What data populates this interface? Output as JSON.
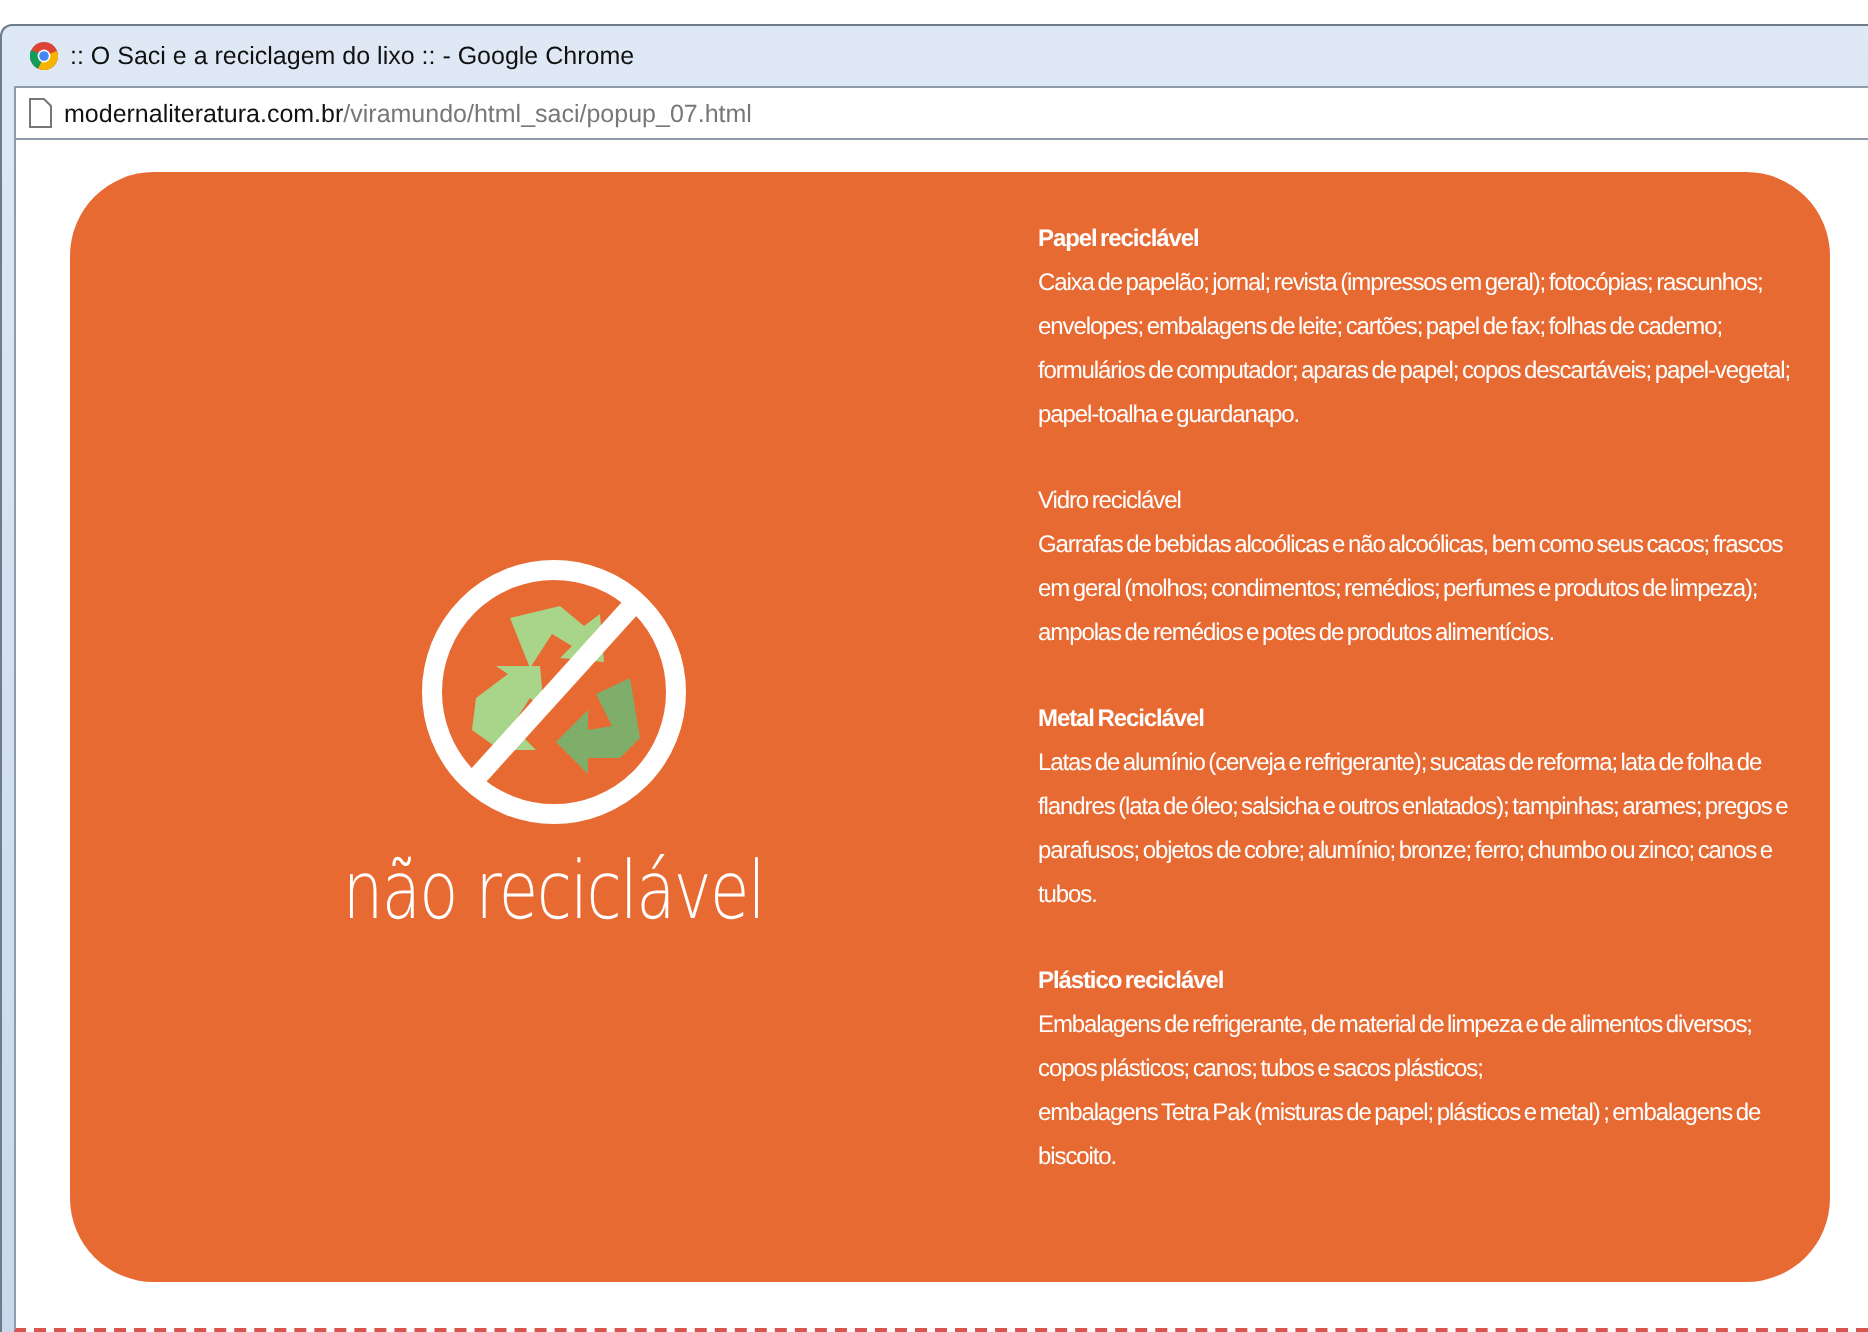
{
  "window": {
    "title": ":: O Saci e a reciclagem do lixo :: - Google Chrome"
  },
  "address_bar": {
    "domain": "modernaliteratura.com.br",
    "path": "/viramundo/html_saci/popup_07.html"
  },
  "card": {
    "caption": "não reciclável",
    "sections": [
      {
        "title": "Papel reciclável",
        "bold": true,
        "paragraphs": [
          "Caixa de papelão; jornal; revista (impressos em geral); fotocópias; rascunhos; envelopes; embalagens de leite; cartões; papel de fax; folhas de cademo; formulários de computador; aparas de papel; copos descartáveis; papel-vegetal; papel-toalha e guardanapo."
        ]
      },
      {
        "title": "Vidro reciclável",
        "bold": false,
        "paragraphs": [
          "Garrafas de bebidas alcoólicas e não alcoólicas, bem como seus cacos; frascos em geral (molhos; condimentos; remédios; perfumes e produtos de limpeza); ampolas de remédios e potes de produtos alimentícios."
        ]
      },
      {
        "title": "Metal Reciclável",
        "bold": true,
        "paragraphs": [
          "Latas de alumínio (cerveja e refrigerante); sucatas de reforma; lata de folha de flandres (lata de óleo; salsicha e outros enlatados); tampinhas; arames; pregos e parafusos; objetos de cobre; alumínio; bronze; ferro; chumbo ou zinco; canos e tubos."
        ]
      },
      {
        "title": "Plástico reciclável",
        "bold": true,
        "paragraphs": [
          "Embalagens de refrigerante, de material de limpeza e de alimentos diversos; copos plásticos; canos; tubos e sacos plásticos;",
          "embalagens Tetra Pak (misturas de papel; plásticos e metal) ; embalagens de biscoito."
        ]
      }
    ]
  }
}
